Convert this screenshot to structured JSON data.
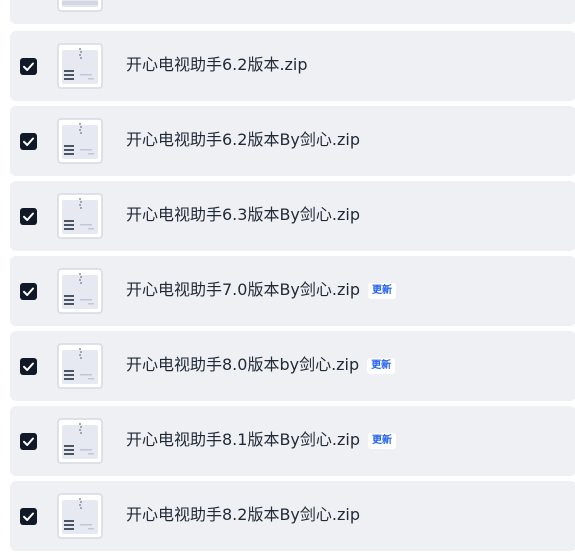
{
  "files": [
    {
      "name": "",
      "checked": true,
      "badge": ""
    },
    {
      "name": "开心电视助手6.2版本.zip",
      "checked": true,
      "badge": ""
    },
    {
      "name": "开心电视助手6.2版本By剑心.zip",
      "checked": true,
      "badge": ""
    },
    {
      "name": "开心电视助手6.3版本By剑心.zip",
      "checked": true,
      "badge": ""
    },
    {
      "name": "开心电视助手7.0版本By剑心.zip",
      "checked": true,
      "badge": "更新"
    },
    {
      "name": "开心电视助手8.0版本by剑心.zip",
      "checked": true,
      "badge": "更新"
    },
    {
      "name": "开心电视助手8.1版本By剑心.zip",
      "checked": true,
      "badge": "更新"
    },
    {
      "name": "开心电视助手8.2版本By剑心.zip",
      "checked": true,
      "badge": ""
    }
  ],
  "icons": {
    "checkbox": "checkbox-checked-icon",
    "file": "zip-file-icon"
  },
  "colors": {
    "row_background": "#eff0f3",
    "checkbox": "#111827",
    "badge_text": "#2563eb"
  }
}
